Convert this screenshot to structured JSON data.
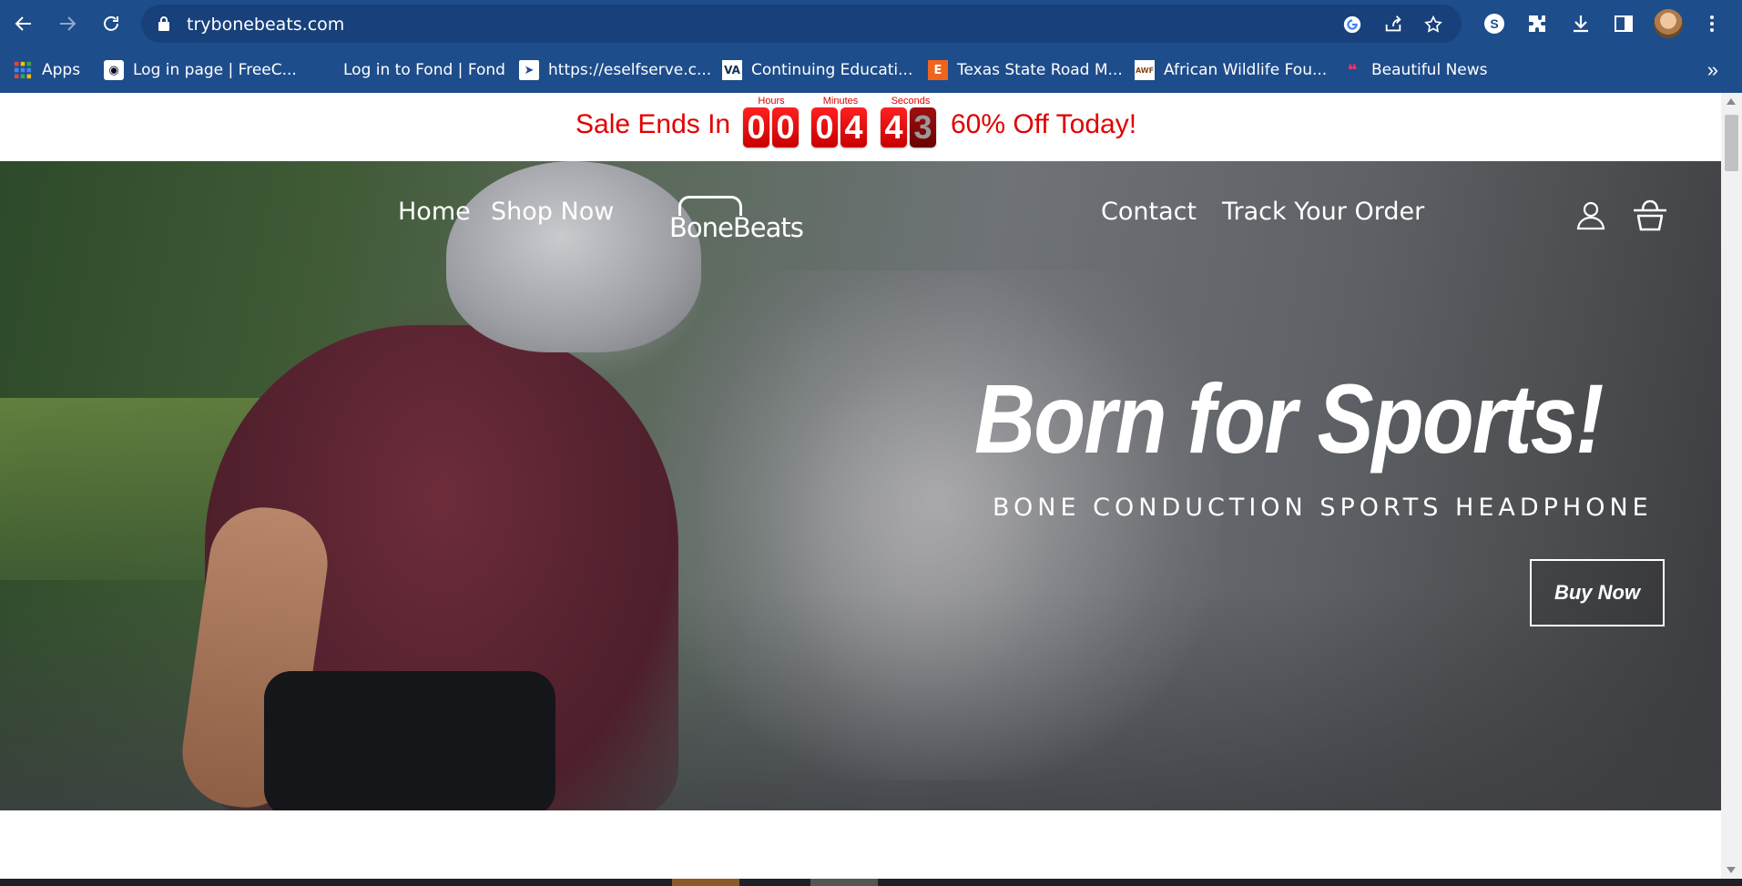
{
  "browser": {
    "url": "trybonebeats.com",
    "bookmarks": [
      {
        "label": "Apps",
        "icon": "apps-grid-icon"
      },
      {
        "label": "Log in page | FreeC...",
        "icon": "freecodecamp-icon"
      },
      {
        "label": "Log in to Fond | Fond",
        "icon": "blank-icon"
      },
      {
        "label": "https://eselfserve.c...",
        "icon": "paper-plane-icon"
      },
      {
        "label": "Continuing Educati...",
        "icon": "va-icon"
      },
      {
        "label": "Texas State Road M...",
        "icon": "etsy-icon"
      },
      {
        "label": "African Wildlife Fou...",
        "icon": "awf-icon"
      },
      {
        "label": "Beautiful News",
        "icon": "beautiful-news-icon"
      }
    ]
  },
  "sale_bar": {
    "lead": "Sale Ends In",
    "trail": "60% Off Today!",
    "labels": {
      "hours": "Hours",
      "minutes": "Minutes",
      "seconds": "Seconds"
    },
    "digits": [
      "0",
      "0",
      "0",
      "4",
      "4",
      "3"
    ],
    "color": "#e00000"
  },
  "nav": {
    "home": "Home",
    "shop": "Shop Now",
    "logo": "BoneBeats",
    "contact": "Contact",
    "track": "Track Your Order"
  },
  "hero": {
    "headline": "Born for Sports!",
    "subhead": "BONE CONDUCTION SPORTS HEADPHONE",
    "cta": "Buy Now"
  }
}
